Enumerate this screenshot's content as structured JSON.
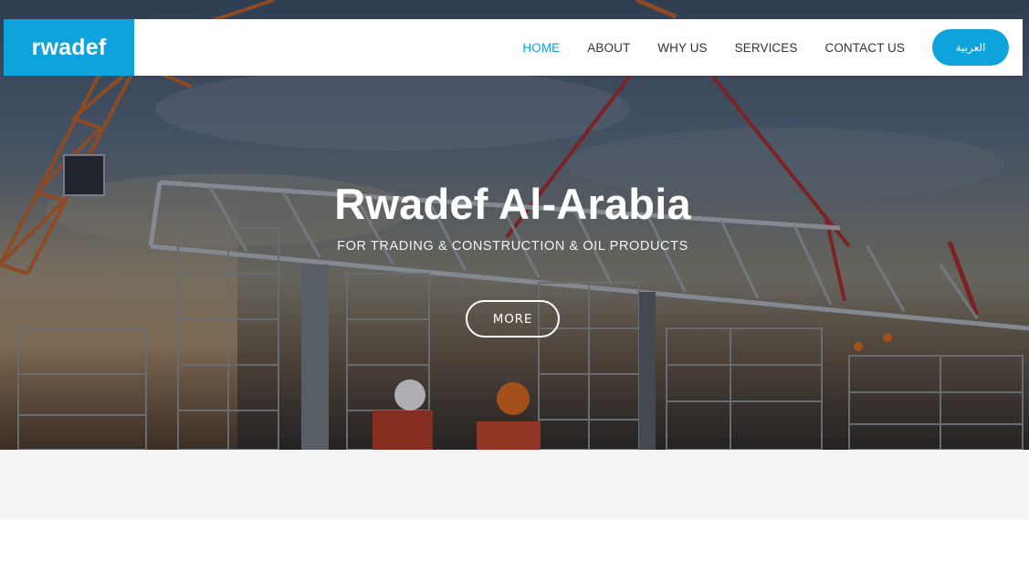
{
  "brand": {
    "logo_text": "rwadef",
    "accent_color": "#0ea3dd"
  },
  "nav": {
    "items": [
      {
        "label": "HOME",
        "active": true
      },
      {
        "label": "ABOUT",
        "active": false
      },
      {
        "label": "WHY US",
        "active": false
      },
      {
        "label": "SERVICES",
        "active": false
      },
      {
        "label": "CONTACT US",
        "active": false
      }
    ],
    "language_button": "العربية"
  },
  "hero": {
    "title": "Rwadef Al-Arabia",
    "subtitle": "FOR TRADING & CONSTRUCTION & OIL PRODUCTS",
    "cta_label": "MORE",
    "background_image": "construction-site-photo"
  }
}
